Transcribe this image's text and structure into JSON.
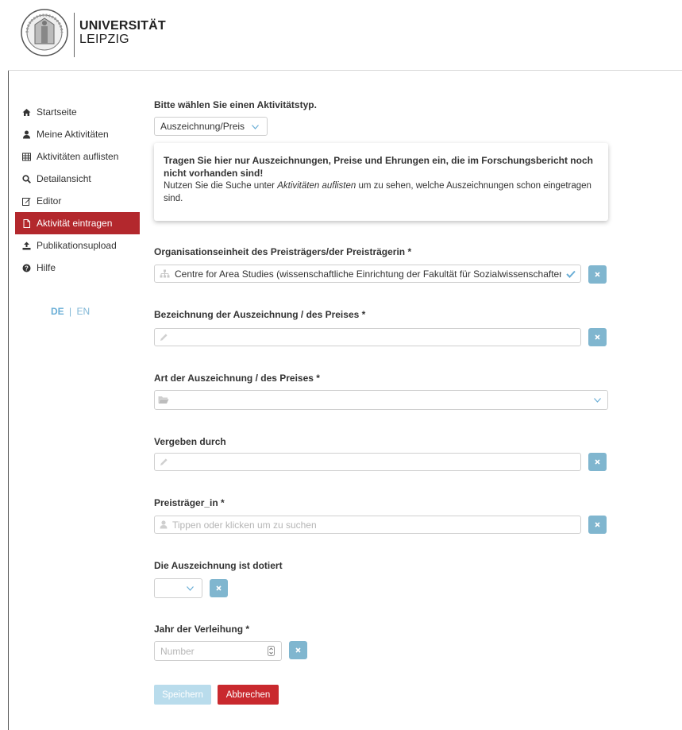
{
  "logo": {
    "line1": "UNIVERSITÄT",
    "line2": "LEIPZIG"
  },
  "sidebar": {
    "items": [
      {
        "label": "Startseite",
        "icon": "home-icon"
      },
      {
        "label": "Meine Aktivitäten",
        "icon": "user-icon"
      },
      {
        "label": "Aktivitäten auflisten",
        "icon": "table-icon"
      },
      {
        "label": "Detailansicht",
        "icon": "search-icon"
      },
      {
        "label": "Editor",
        "icon": "edit-icon"
      },
      {
        "label": "Aktivität eintragen",
        "icon": "file-icon",
        "active": true
      },
      {
        "label": "Publikationsupload",
        "icon": "upload-icon"
      },
      {
        "label": "Hilfe",
        "icon": "question-icon"
      }
    ],
    "lang_de": "DE",
    "lang_sep": "|",
    "lang_en": "EN"
  },
  "activity_type": {
    "label": "Bitte wählen Sie einen Aktivitätstyp.",
    "selected": "Auszeichnung/Preis"
  },
  "info": {
    "line_strong": "Tragen Sie hier nur Auszeichnungen, Preise und Ehrungen ein, die im Forschungsbericht noch nicht vorhanden sind!",
    "line_pre": "Nutzen Sie die Suche unter ",
    "line_link": "Aktivitäten auflisten",
    "line_post": " um zu sehen, welche Auszeichnungen schon eingetragen sind."
  },
  "fields": {
    "org": {
      "label": "Organisationseinheit des Preisträgers/der Preisträgerin *",
      "value": "Centre for Area Studies (wissenschaftliche Einrichtung der Fakultät für Sozialwissenschaften"
    },
    "name": {
      "label": "Bezeichnung der Auszeichnung / des Preises *",
      "value": ""
    },
    "type": {
      "label": "Art der Auszeichnung / des Preises *",
      "value": ""
    },
    "by": {
      "label": "Vergeben durch",
      "value": ""
    },
    "winner": {
      "label": "Preisträger_in *",
      "placeholder": "Tippen oder klicken um zu suchen"
    },
    "endowed": {
      "label": "Die Auszeichnung ist dotiert",
      "value": ""
    },
    "year": {
      "label": "Jahr der Verleihung *",
      "placeholder": "Number"
    }
  },
  "buttons": {
    "save": "Speichern",
    "cancel": "Abbrechen"
  },
  "colors": {
    "accent_red": "#b3282d",
    "clear_blue": "#80b6cf",
    "save_disabled": "#b9dcec",
    "lang_blue": "#6aaed6"
  }
}
